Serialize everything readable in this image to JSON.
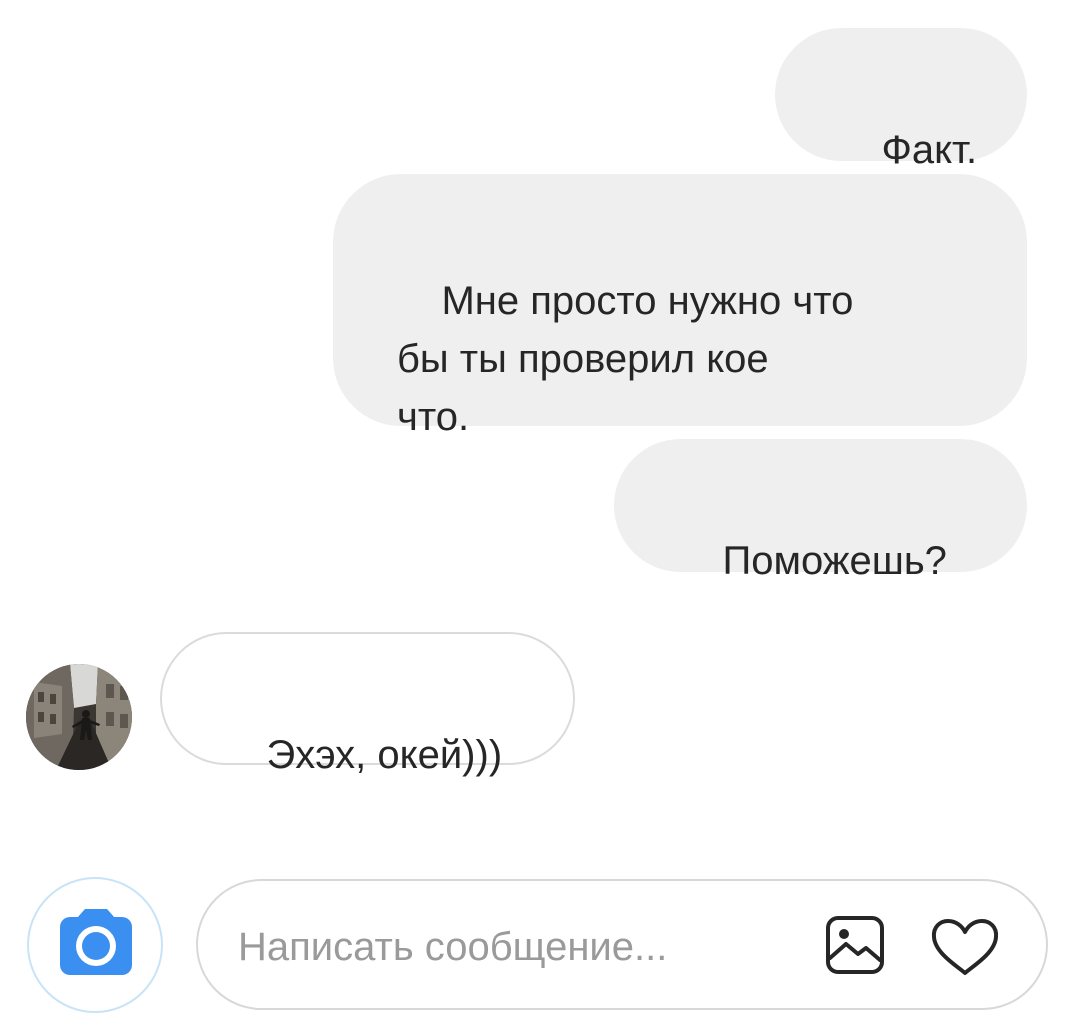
{
  "messages": [
    {
      "direction": "outgoing",
      "text": "Факт."
    },
    {
      "direction": "outgoing",
      "text": "Мне просто нужно что\nбы ты проверил кое\nчто."
    },
    {
      "direction": "outgoing",
      "text": "Поможешь?"
    },
    {
      "direction": "incoming",
      "text": "Эхэх, окей)))"
    }
  ],
  "composer": {
    "placeholder": "Написать сообщение..."
  },
  "icons": {
    "camera": "camera-icon",
    "gallery": "gallery-icon",
    "like": "heart-icon",
    "avatar": "avatar"
  },
  "colors": {
    "outgoing_bubble": "#efefef",
    "incoming_border": "#dbdbdb",
    "camera_blue": "#3b8ff0",
    "text": "#262626",
    "placeholder": "#9a9a9a"
  }
}
